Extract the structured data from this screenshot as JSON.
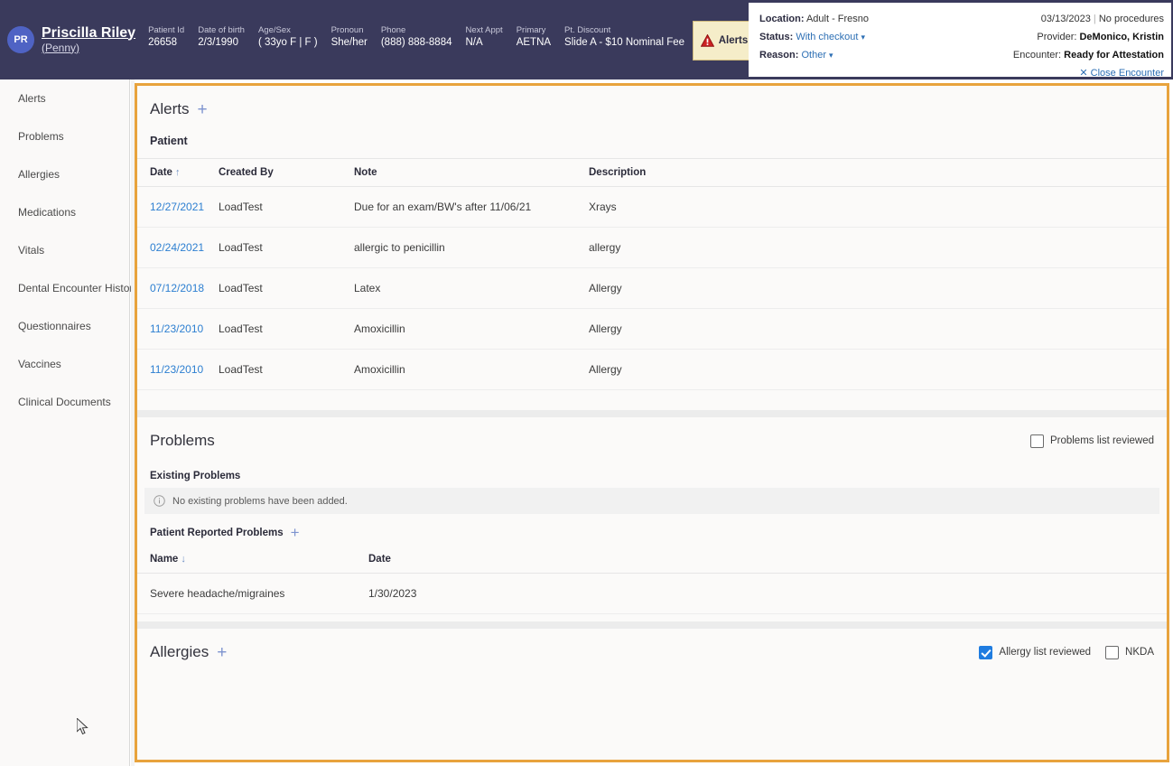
{
  "header": {
    "avatar_initials": "PR",
    "patient_name": "Priscilla Riley",
    "patient_nickname": "(Penny)",
    "demographics": [
      {
        "label": "Patient Id",
        "value": "26658"
      },
      {
        "label": "Date of birth",
        "value": "2/3/1990"
      },
      {
        "label": "Age/Sex",
        "value": "( 33yo F | F )"
      },
      {
        "label": "Pronoun",
        "value": "She/her"
      },
      {
        "label": "Phone",
        "value": "(888) 888-8884"
      },
      {
        "label": "Next Appt",
        "value": "N/A"
      },
      {
        "label": "Primary",
        "value": "AETNA"
      },
      {
        "label": "Pt. Discount",
        "value": "Slide A - $10 Nominal Fee"
      }
    ],
    "alerts_button_label": "Alerts",
    "encounter": {
      "location_label": "Location:",
      "location_value": "Adult - Fresno",
      "status_label": "Status:",
      "status_value": "With checkout",
      "reason_label": "Reason:",
      "reason_value": "Other",
      "date": "03/13/2023",
      "procedures": "No procedures",
      "provider_label": "Provider:",
      "provider_value": "DeMonico, Kristin",
      "encounter_label": "Encounter:",
      "encounter_value": "Ready for Attestation",
      "close_label": "Close Encounter"
    }
  },
  "sidebar": {
    "items": [
      {
        "label": "Alerts"
      },
      {
        "label": "Problems"
      },
      {
        "label": "Allergies"
      },
      {
        "label": "Medications"
      },
      {
        "label": "Vitals"
      },
      {
        "label": "Dental Encounter History"
      },
      {
        "label": "Questionnaires"
      },
      {
        "label": "Vaccines"
      },
      {
        "label": "Clinical Documents"
      }
    ]
  },
  "alerts_section": {
    "title": "Alerts",
    "add_label": "+",
    "subheading": "Patient",
    "columns": [
      "Date",
      "Created By",
      "Note",
      "Description"
    ],
    "sort_arrow": "↑",
    "rows": [
      {
        "date": "12/27/2021",
        "created_by": "LoadTest",
        "note": "Due for an exam/BW's after 11/06/21",
        "description": "Xrays"
      },
      {
        "date": "02/24/2021",
        "created_by": "LoadTest",
        "note": "allergic to penicillin",
        "description": "allergy"
      },
      {
        "date": "07/12/2018",
        "created_by": "LoadTest",
        "note": "Latex",
        "description": "Allergy"
      },
      {
        "date": "11/23/2010",
        "created_by": "LoadTest",
        "note": "Amoxicillin",
        "description": "Allergy"
      },
      {
        "date": "11/23/2010",
        "created_by": "LoadTest",
        "note": "Amoxicillin",
        "description": "Allergy"
      }
    ]
  },
  "problems_section": {
    "title": "Problems",
    "reviewed_label": "Problems list reviewed",
    "reviewed_checked": false,
    "existing_label": "Existing Problems",
    "empty_message": "No existing problems have been added.",
    "reported_label": "Patient Reported Problems",
    "add_label": "+",
    "columns": [
      "Name",
      "Date"
    ],
    "sort_arrow": "↓",
    "rows": [
      {
        "name": "Severe headache/migraines",
        "date": "1/30/2023"
      }
    ]
  },
  "allergies_section": {
    "title": "Allergies",
    "add_label": "+",
    "reviewed_label": "Allergy list reviewed",
    "reviewed_checked": true,
    "nkda_label": "NKDA",
    "nkda_checked": false
  },
  "colors": {
    "header_bg": "#3a3a5c",
    "accent_border": "#e8a33d",
    "link": "#2d7fd1",
    "checkbox_checked": "#1f7ce0",
    "alert_btn_bg": "#f5edc9",
    "alert_triangle": "#cc2222"
  }
}
